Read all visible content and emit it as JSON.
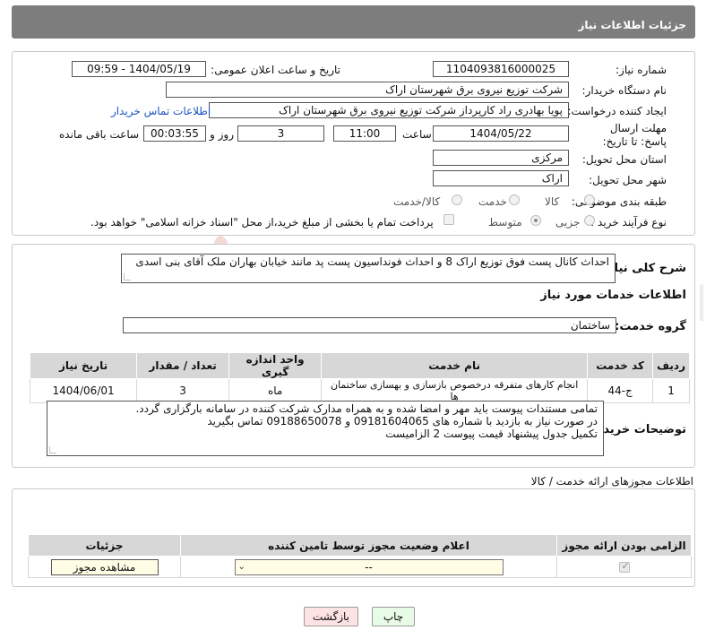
{
  "header": {
    "title": "جزئیات اطلاعات نیاز"
  },
  "fields": {
    "need_number_label": "شماره نیاز:",
    "need_number": "1104093816000025",
    "announce_label": "تاریخ و ساعت اعلان عمومی:",
    "announce_value": "1404/05/19 - 09:59",
    "buyer_org_label": "نام دستگاه خریدار:",
    "buyer_org": "شرکت توزیع نیروی برق شهرستان اراک",
    "creator_label": "ایجاد کننده درخواست:",
    "creator": "پویا بهادری راد کارپرداز شرکت توزیع نیروی برق شهرستان اراک",
    "buyer_contact_link": "اطلاعات تماس خریدار",
    "deadline_label": "مهلت ارسال پاسخ: تا تاریخ:",
    "deadline_date": "1404/05/22",
    "time_label": "ساعت",
    "deadline_time": "11:00",
    "days_value": "3",
    "days_label": "روز و",
    "remaining_time": "00:03:55",
    "remaining_label": "ساعت باقی مانده",
    "province_label": "استان محل تحویل:",
    "province": "مرکزی",
    "city_label": "شهر محل تحویل:",
    "city": "اراک",
    "category_label": "طبقه بندی موضوعی:",
    "category_options": [
      "کالا",
      "خدمت",
      "کالا/خدمت"
    ],
    "process_label": "نوع فرآیند خرید :",
    "process_options": [
      "جزیی",
      "متوسط"
    ],
    "payment_note": "پرداخت تمام یا بخشی از مبلغ خرید،از محل \"اسناد خزانه اسلامی\" خواهد بود."
  },
  "summary": {
    "label": "شرح کلی نیاز:",
    "text": "احداث کانال پست فوق توزیع اراک 8 و احداث فونداسیون پست پد مانند خیابان بهاران ملک آقای بنی اسدی"
  },
  "services": {
    "section_title": "اطلاعات خدمات مورد نیاز",
    "group_label": "گروه خدمت:",
    "group_value": "ساختمان",
    "columns": [
      "ردیف",
      "کد خدمت",
      "نام خدمت",
      "واحد اندازه گیری",
      "تعداد / مقدار",
      "تاریخ نیاز"
    ],
    "rows": [
      [
        "1",
        "ج-44",
        "انجام کارهای متفرقه درخصوص بازسازی و بهسازی ساختمان ها",
        "ماه",
        "3",
        "1404/06/01"
      ]
    ]
  },
  "buyer_notes": {
    "label": "توضیحات خریدار:",
    "lines": [
      "تمامی مستندات پیوست باید مهر و امضا شده و به همراه مدارک شرکت کننده در سامانه بارگزاری گردد.",
      "در صورت نیاز به بازدید با شماره های 09181604065 و 09188650078 تماس بگیرید",
      "تکمیل جدول پیشنهاد قیمت پیوست 2 الزامیست"
    ]
  },
  "permits": {
    "section_title": "اطلاعات مجوزهای ارائه خدمت / کالا",
    "columns": [
      "الزامی بودن ارائه مجوز",
      "اعلام وضعیت مجوز توسط تامین کننده",
      "جزئیات"
    ],
    "select_value": "--",
    "view_button": "مشاهده مجوز"
  },
  "actions": {
    "print": "چاپ",
    "back": "بازگشت"
  },
  "watermark": {
    "text": "AriaTender.neT"
  }
}
